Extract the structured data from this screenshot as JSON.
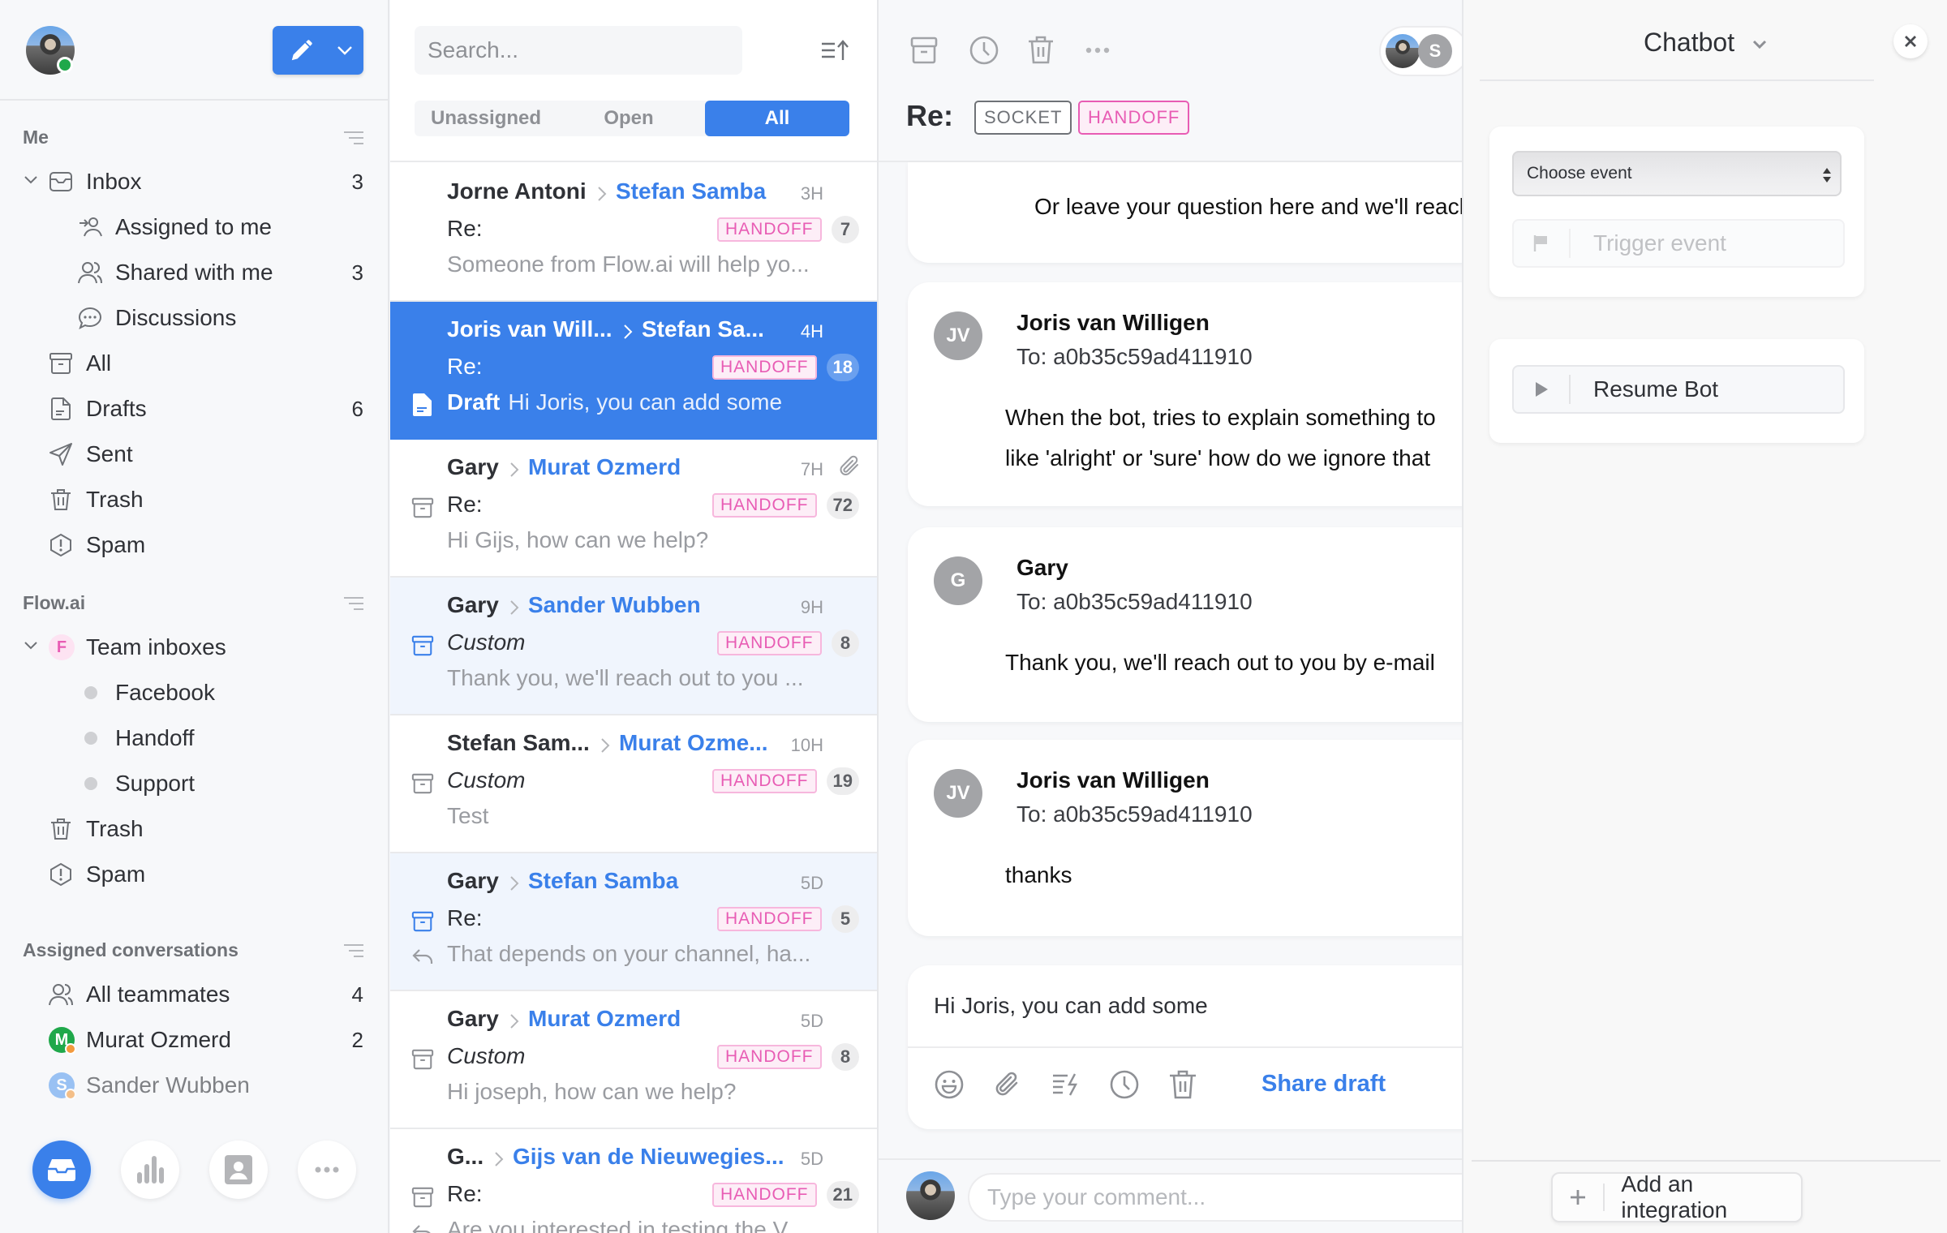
{
  "sidebar": {
    "compose_button": "compose",
    "sections": {
      "me": "Me",
      "flow": "Flow.ai",
      "assigned": "Assigned conversations"
    },
    "me_items": [
      {
        "label": "Inbox",
        "count": "3",
        "icon": "inbox-icon"
      },
      {
        "label": "Assigned to me",
        "count": "",
        "icon": "assigned-user-icon"
      },
      {
        "label": "Shared with me",
        "count": "3",
        "icon": "users-icon"
      },
      {
        "label": "Discussions",
        "count": "",
        "icon": "chat-bubble-icon"
      },
      {
        "label": "All",
        "count": "",
        "icon": "archive-icon"
      },
      {
        "label": "Drafts",
        "count": "6",
        "icon": "draft-document-icon"
      },
      {
        "label": "Sent",
        "count": "",
        "icon": "send-icon"
      },
      {
        "label": "Trash",
        "count": "",
        "icon": "trash-icon"
      },
      {
        "label": "Spam",
        "count": "",
        "icon": "spam-icon"
      }
    ],
    "team": {
      "badge_letter": "F",
      "label": "Team inboxes",
      "inboxes": [
        "Facebook",
        "Handoff",
        "Support"
      ],
      "trash": "Trash",
      "spam": "Spam"
    },
    "assigned_items": [
      {
        "label": "All teammates",
        "count": "4",
        "avatar": ""
      },
      {
        "label": "Murat Ozmerd",
        "count": "2",
        "avatar": "M"
      },
      {
        "label": "Sander Wubben",
        "count": "",
        "avatar": "S"
      }
    ],
    "bottom_nav": [
      "inbox",
      "analytics",
      "contacts",
      "more"
    ]
  },
  "conversation_list": {
    "search_placeholder": "Search...",
    "filters": [
      "Unassigned",
      "Open",
      "All"
    ],
    "active_filter": "All",
    "items": [
      {
        "from": "Jorne Antoni",
        "to": "Stefan Samba",
        "time": "3H",
        "subject": "Re:",
        "subject_italic": false,
        "tag": "HANDOFF",
        "count": "7",
        "preview": "Someone from Flow.ai will help yo...",
        "state": "read",
        "left_icon": "",
        "attachment": false,
        "draft_label": ""
      },
      {
        "from": "Joris van Will...",
        "to": "Stefan Sa...",
        "time": "4H",
        "subject": "Re:",
        "subject_italic": false,
        "tag": "HANDOFF",
        "count": "18",
        "preview": "Hi Joris, you can add some",
        "state": "selected",
        "left_icon": "draft-icon",
        "attachment": false,
        "draft_label": "Draft"
      },
      {
        "from": "Gary",
        "to": "Murat Ozmerd",
        "time": "7H",
        "subject": "Re:",
        "subject_italic": false,
        "tag": "HANDOFF",
        "count": "72",
        "preview": "Hi Gijs, how can we help?",
        "state": "read",
        "left_icon": "archive-icon",
        "attachment": true,
        "draft_label": ""
      },
      {
        "from": "Gary",
        "to": "Sander Wubben",
        "time": "9H",
        "subject": "Custom",
        "subject_italic": true,
        "tag": "HANDOFF",
        "count": "8",
        "preview": "Thank you, we'll reach out to you ...",
        "state": "unread",
        "left_icon": "archive-icon",
        "attachment": false,
        "draft_label": ""
      },
      {
        "from": "Stefan Sam...",
        "to": "Murat Ozme...",
        "time": "10H",
        "subject": "Custom",
        "subject_italic": true,
        "tag": "HANDOFF",
        "count": "19",
        "preview": "Test",
        "state": "read",
        "left_icon": "archive-icon",
        "attachment": false,
        "draft_label": ""
      },
      {
        "from": "Gary",
        "to": "Stefan Samba",
        "time": "5D",
        "subject": "Re:",
        "subject_italic": false,
        "tag": "HANDOFF",
        "count": "5",
        "preview": "That depends on your channel, ha...",
        "state": "unread",
        "left_icon": "archive-icon",
        "attachment": false,
        "draft_label": "",
        "replied": true
      },
      {
        "from": "Gary",
        "to": "Murat Ozmerd",
        "time": "5D",
        "subject": "Custom",
        "subject_italic": true,
        "tag": "HANDOFF",
        "count": "8",
        "preview": "Hi joseph, how can we help?",
        "state": "read",
        "left_icon": "archive-icon",
        "attachment": false,
        "draft_label": ""
      },
      {
        "from": "G...",
        "to": "Gijs van de Nieuwegies...",
        "time": "5D",
        "subject": "Re:",
        "subject_italic": false,
        "tag": "HANDOFF",
        "count": "21",
        "preview": "Are you interested in testing the V...",
        "state": "read",
        "left_icon": "archive-icon",
        "attachment": false,
        "draft_label": "",
        "replied": true
      }
    ]
  },
  "conversation": {
    "toolbar": [
      "archive",
      "snooze",
      "delete",
      "more"
    ],
    "assignee_initial": "S",
    "subject": "Re:",
    "tags": [
      "SOCKET",
      "HANDOFF"
    ],
    "messages": [
      {
        "name": "",
        "initials": "",
        "to": "",
        "body": [
          "Or leave your question here and we'll reach"
        ]
      },
      {
        "name": "Joris van Willigen",
        "initials": "JV",
        "to": "To: a0b35c59ad411910",
        "body": [
          "When the bot, tries to explain something to",
          "like 'alright' or 'sure' how do we ignore that"
        ]
      },
      {
        "name": "Gary",
        "initials": "G",
        "to": "To: a0b35c59ad411910",
        "body": [
          "Thank you, we'll reach out to you by e-mail"
        ]
      },
      {
        "name": "Joris van Willigen",
        "initials": "JV",
        "to": "To: a0b35c59ad411910",
        "body": [
          "thanks"
        ]
      }
    ],
    "draft": {
      "text": "Hi Joris, you can add some",
      "share_label": "Share draft"
    },
    "comment_placeholder": "Type your comment..."
  },
  "right_panel": {
    "title": "Chatbot",
    "select_value": "Choose event",
    "trigger_label": "Trigger event",
    "resume_label": "Resume Bot",
    "add_integration_label": "Add an integration"
  },
  "colors": {
    "accent": "#3a80ea",
    "tag_pink": "#e85cb4",
    "online": "#1fa84a"
  }
}
